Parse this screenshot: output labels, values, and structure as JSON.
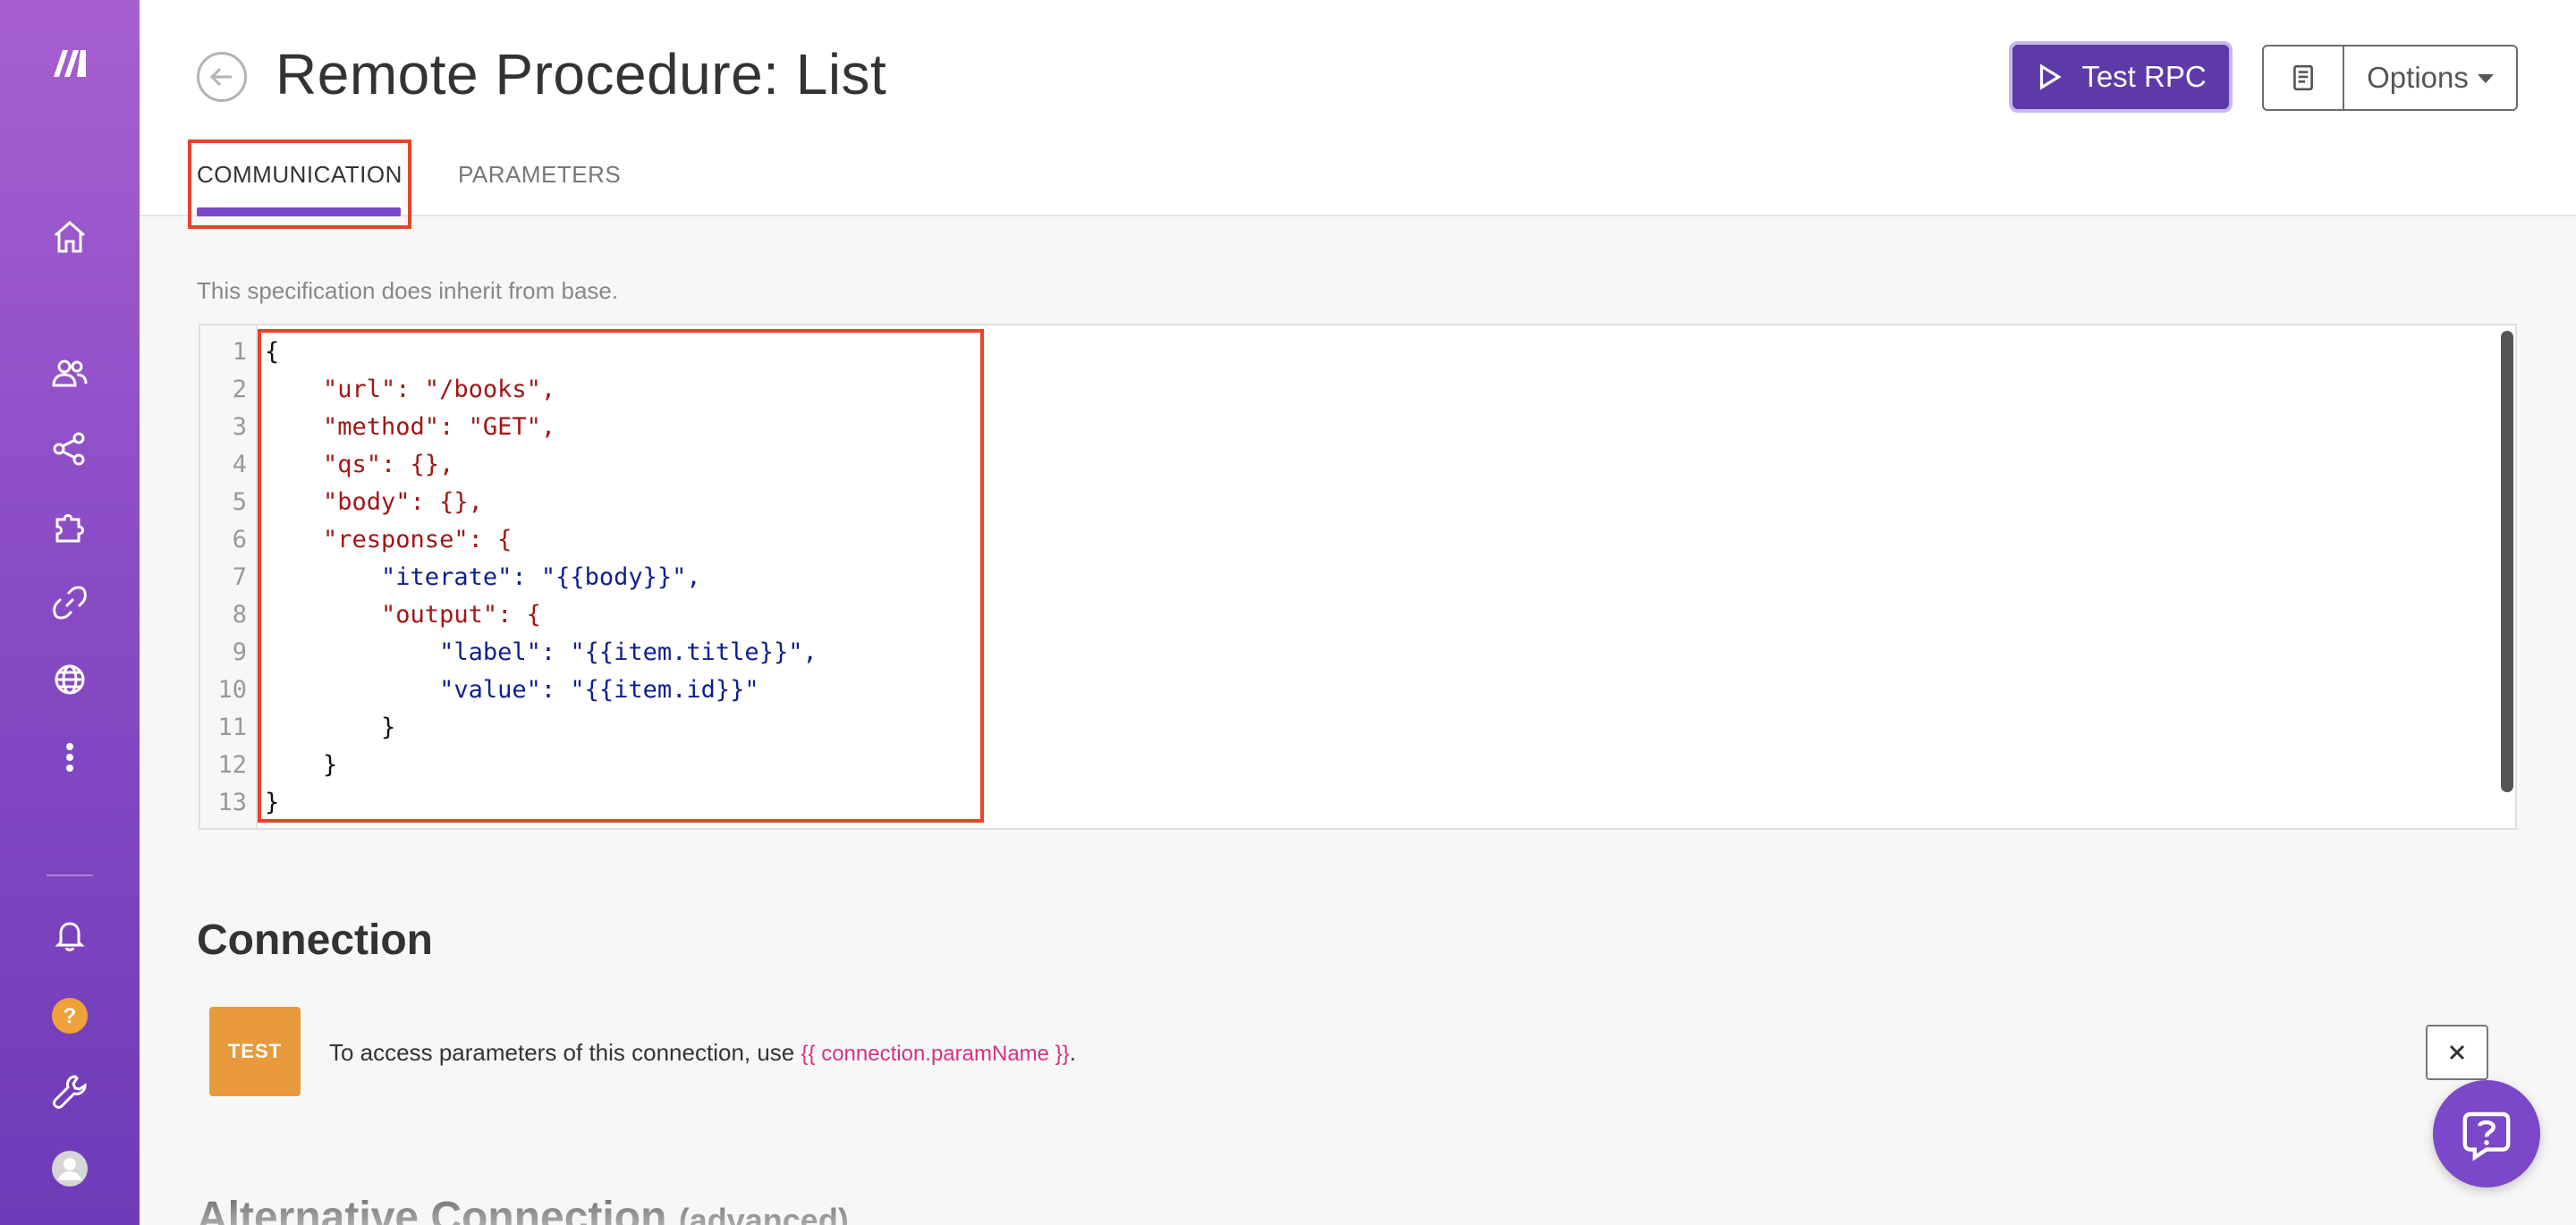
{
  "sidebar": {
    "items": [
      {
        "name": "home",
        "icon": "home-icon"
      },
      {
        "name": "team",
        "icon": "users-icon"
      },
      {
        "name": "share",
        "icon": "share-icon"
      },
      {
        "name": "apps",
        "icon": "puzzle-icon"
      },
      {
        "name": "connections",
        "icon": "link-icon"
      },
      {
        "name": "webhooks",
        "icon": "globe-icon"
      },
      {
        "name": "more",
        "icon": "more-vertical-icon"
      },
      {
        "name": "notifications",
        "icon": "bell-icon"
      },
      {
        "name": "help",
        "icon": "question-icon"
      },
      {
        "name": "tools",
        "icon": "wrench-icon"
      },
      {
        "name": "profile",
        "icon": "avatar-icon"
      }
    ]
  },
  "header": {
    "title": "Remote Procedure: List",
    "tabs": [
      {
        "label": "COMMUNICATION",
        "active": true
      },
      {
        "label": "PARAMETERS",
        "active": false
      }
    ],
    "test_button_label": "Test RPC",
    "options_label": "Options"
  },
  "content": {
    "inherit_note": "This specification does inherit from base.",
    "code_lines": [
      "{",
      "    \"url\": \"/books\",",
      "    \"method\": \"GET\",",
      "    \"qs\": {},",
      "    \"body\": {},",
      "    \"response\": {",
      "        \"iterate\": \"{{body}}\",",
      "        \"output\": {",
      "            \"label\": \"{{item.title}}\",",
      "            \"value\": \"{{item.id}}\"",
      "        }",
      "    }",
      "}"
    ],
    "connection": {
      "title": "Connection",
      "badge": "TEST",
      "text_prefix": "To access parameters of this connection, use ",
      "text_code": "{{ connection.paramName }}",
      "text_suffix": "."
    },
    "alt_connection": {
      "title": "Alternative Connection",
      "suffix": "(advanced)"
    }
  },
  "colors": {
    "accent": "#7b48c9",
    "button_primary": "#5d3aa8",
    "badge": "#e99a3c",
    "highlight": "#e8442a",
    "code_key": "#a31515",
    "code_template": "#0f1f8f"
  }
}
